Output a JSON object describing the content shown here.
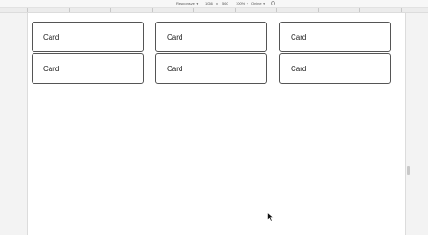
{
  "toolbar": {
    "device": "Responsive",
    "width": "1066",
    "times": "x",
    "height": "560",
    "zoom": "100%",
    "network": "Online",
    "caret": "▼",
    "rotate_icon": "rotate-icon"
  },
  "page": {
    "cards": [
      {
        "label": "Card"
      },
      {
        "label": "Card"
      },
      {
        "label": "Card"
      },
      {
        "label": "Card"
      },
      {
        "label": "Card"
      },
      {
        "label": "Card"
      }
    ]
  },
  "colors": {
    "card_border": "#555555",
    "viewport_bg": "#ffffff",
    "chrome_bg": "#f3f3f3"
  },
  "icons": {
    "cursor": "mouse-pointer-icon",
    "resize": "resize-handle-icon"
  }
}
